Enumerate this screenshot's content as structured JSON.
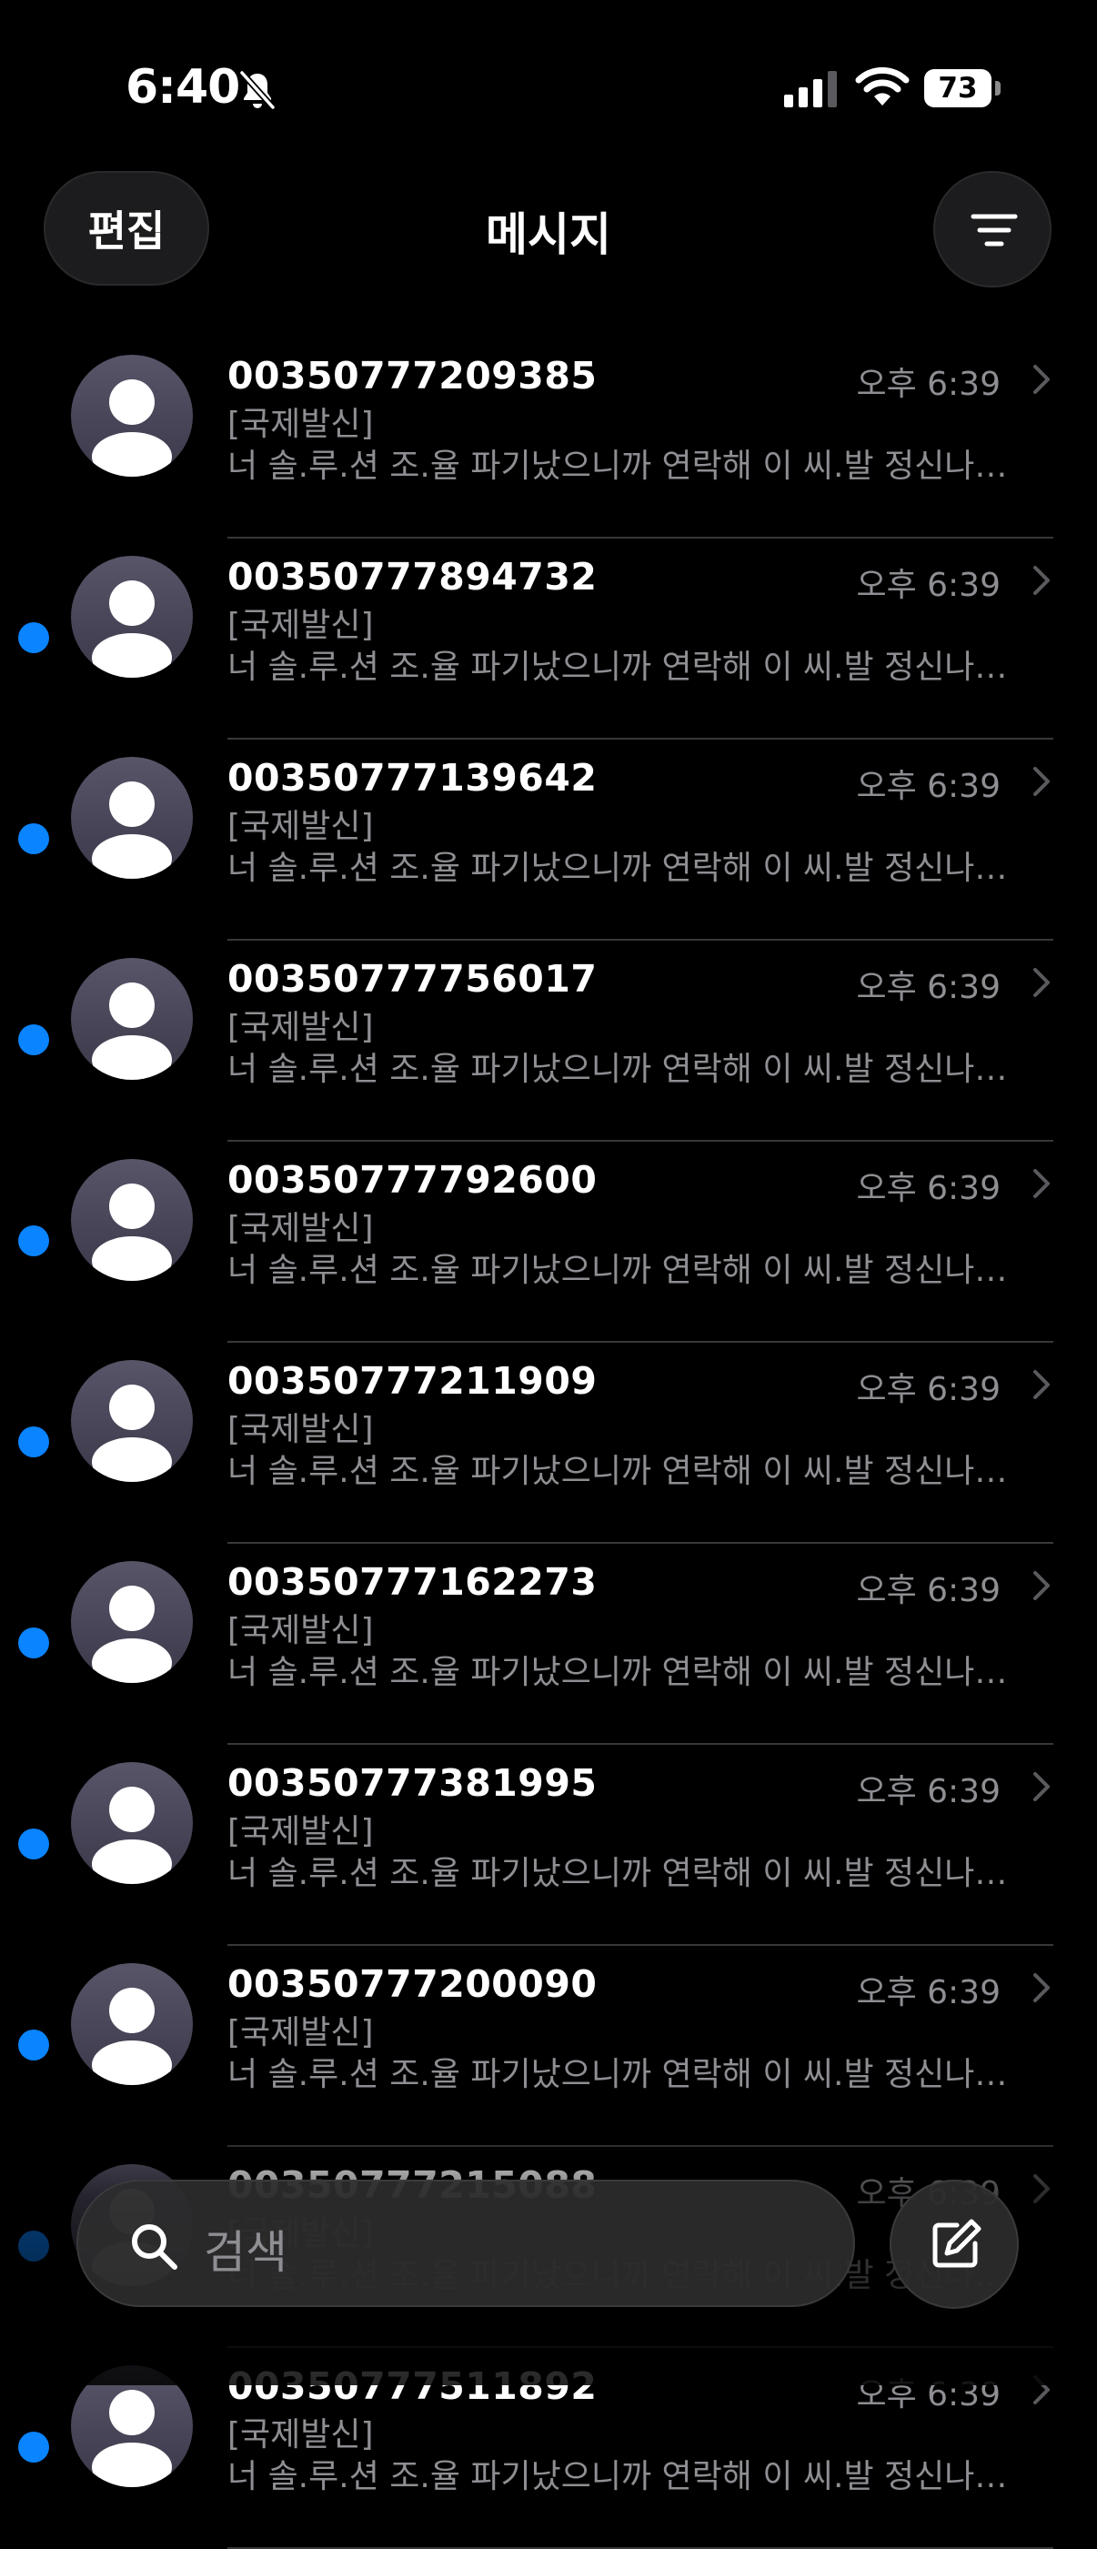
{
  "status_bar": {
    "time": "6:40",
    "battery": "73",
    "icons": [
      "bell-slash-icon",
      "cellular-signal-icon",
      "wifi-icon",
      "battery-icon"
    ]
  },
  "header": {
    "edit_label": "편집",
    "title": "메시지",
    "filter_icon": "filter-icon"
  },
  "conversations": [
    {
      "sender": "00350777209385",
      "time": "오후 6:39",
      "line1": "[국제발신]",
      "preview": "너 솔.루.션 조.율 파기났으니까 연락해 이 씨.발 정신나간년아...",
      "unread": false
    },
    {
      "sender": "00350777894732",
      "time": "오후 6:39",
      "line1": "[국제발신]",
      "preview": "너 솔.루.션 조.율 파기났으니까 연락해 이 씨.발 정신나간년아...",
      "unread": true
    },
    {
      "sender": "00350777139642",
      "time": "오후 6:39",
      "line1": "[국제발신]",
      "preview": "너 솔.루.션 조.율 파기났으니까 연락해 이 씨.발 정신나간년아...",
      "unread": true
    },
    {
      "sender": "00350777756017",
      "time": "오후 6:39",
      "line1": "[국제발신]",
      "preview": "너 솔.루.션 조.율 파기났으니까 연락해 이 씨.발 정신나간년아...",
      "unread": true
    },
    {
      "sender": "00350777792600",
      "time": "오후 6:39",
      "line1": "[국제발신]",
      "preview": "너 솔.루.션 조.율 파기났으니까 연락해 이 씨.발 정신나간년아...",
      "unread": true
    },
    {
      "sender": "00350777211909",
      "time": "오후 6:39",
      "line1": "[국제발신]",
      "preview": "너 솔.루.션 조.율 파기났으니까 연락해 이 씨.발 정신나간년아...",
      "unread": true
    },
    {
      "sender": "00350777162273",
      "time": "오후 6:39",
      "line1": "[국제발신]",
      "preview": "너 솔.루.션 조.율 파기났으니까 연락해 이 씨.발 정신나간년아...",
      "unread": true
    },
    {
      "sender": "00350777381995",
      "time": "오후 6:39",
      "line1": "[국제발신]",
      "preview": "너 솔.루.션 조.율 파기났으니까 연락해 이 씨.발 정신나간년아...",
      "unread": true
    },
    {
      "sender": "00350777200090",
      "time": "오후 6:39",
      "line1": "[국제발신]",
      "preview": "너 솔.루.션 조.율 파기났으니까 연락해 이 씨.발 정신나간년아...",
      "unread": true
    },
    {
      "sender": "00350777215088",
      "time": "오후 6:39",
      "line1": "[국제발신]",
      "preview": "너 솔.루.션 조.율 파기났으니까 연락해 이 씨.발 정신나간년아...",
      "unread": true
    },
    {
      "sender": "00350777511892",
      "time": "오후 6:39",
      "line1": "[국제발신]",
      "preview": "너 솔.루.션 조.율 파기났으니까 연락해 이 씨.발 정신나간년아...",
      "unread": true
    }
  ],
  "bottom_bar": {
    "search_placeholder": "검색",
    "search_icon": "search-icon",
    "compose_icon": "compose-icon"
  },
  "colors": {
    "background": "#000000",
    "unread_dot": "#0a84ff",
    "secondary_text": "#8e8e93",
    "separator": "#38383a"
  }
}
